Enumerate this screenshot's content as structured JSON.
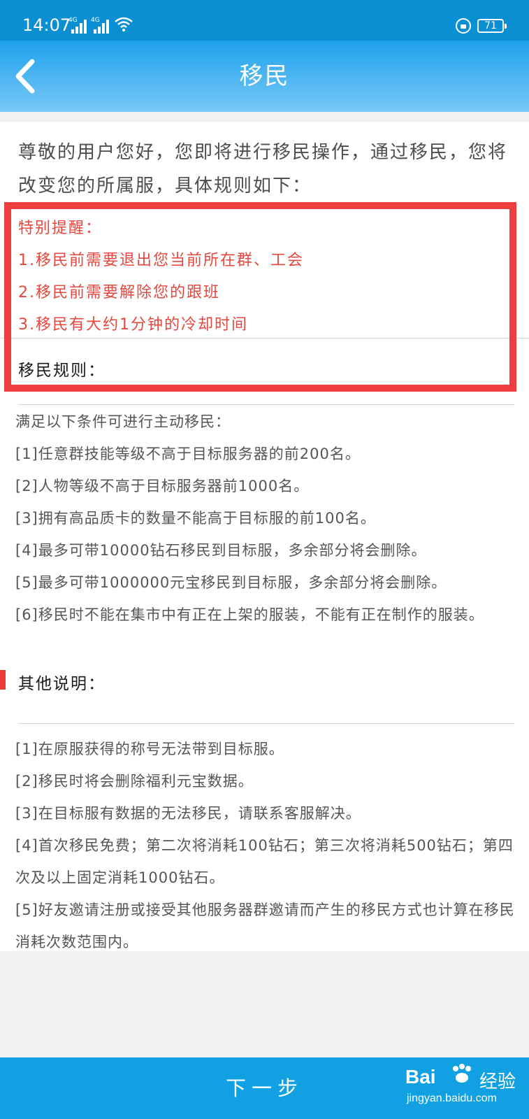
{
  "status_bar": {
    "time": "14:07",
    "network_1": "4G",
    "network_2": "4G",
    "battery": "71"
  },
  "header": {
    "title": "移民"
  },
  "intro": "尊敬的用户您好，您即将进行移民操作，通过移民，您将改变您的所属服，具体规则如下：",
  "reminder": {
    "title": "特别提醒：",
    "items": [
      "1.移民前需要退出您当前所在群、工会",
      "2.移民前需要解除您的跟班",
      "3.移民有大约1分钟的冷却时间"
    ]
  },
  "rules": {
    "title": "移民规则：",
    "lead": "满足以下条件可进行主动移民：",
    "items": [
      "[1]任意群技能等级不高于目标服务器的前200名。",
      "[2]人物等级不高于目标服务器前1000名。",
      "[3]拥有高品质卡的数量不能高于目标服的前100名。",
      "[4]最多可带10000钻石移民到目标服，多余部分将会删除。",
      "[5]最多可带1000000元宝移民到目标服，多余部分将会删除。",
      "[6]移民时不能在集市中有正在上架的服装，不能有正在制作的服装。"
    ]
  },
  "other": {
    "title": "其他说明：",
    "items": [
      "[1]在原服获得的称号无法带到目标服。",
      "[2]移民时将会删除福利元宝数据。",
      "[3]在目标服有数据的无法移民，请联系客服解决。",
      "[4]首次移民免费；第二次将消耗100钻石；第三次将消耗500钻石；第四次及以上固定消耗1000钻石。",
      "[5]好友邀请注册或接受其他服务器群邀请而产生的移民方式也计算在移民消耗次数范围内。"
    ]
  },
  "footer": {
    "next_label": "下一步"
  },
  "watermark": {
    "logo": "Bai",
    "suffix": "经验",
    "url": "jingyan.baidu.com"
  }
}
